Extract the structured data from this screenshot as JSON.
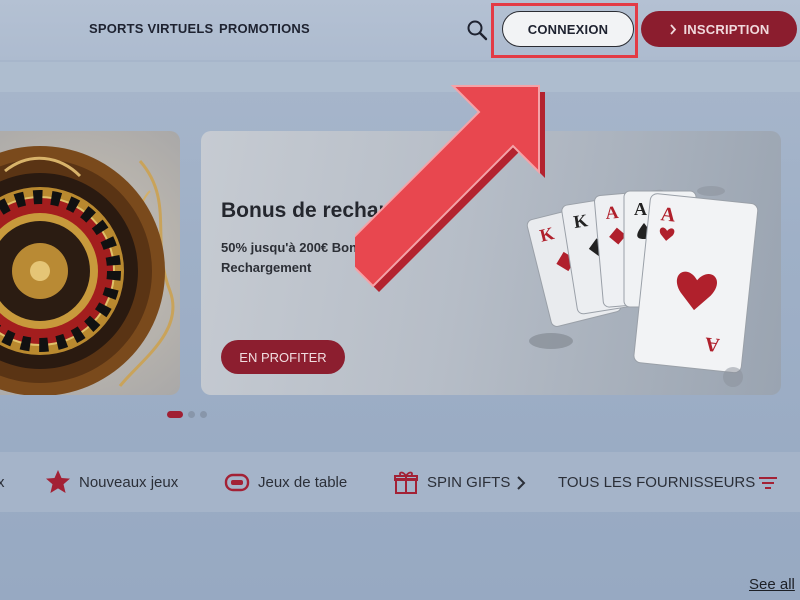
{
  "header": {
    "nav": [
      "SPORTS VIRTUELS",
      "PROMOTIONS"
    ],
    "login_label": "CONNEXION",
    "register_label": "INSCRIPTION"
  },
  "carousel": {
    "active_slide": {
      "title": "Bonus de recharge",
      "description": "50% jusqu'à 200€ Bonus Rechargement",
      "cta_label": "EN PROFITER"
    },
    "pagination": {
      "count": 3,
      "active_index": 0
    }
  },
  "categories": {
    "items": [
      {
        "label": "Nouveaux jeux",
        "icon": "star-icon"
      },
      {
        "label": "Jeux de table",
        "icon": "table-games-icon"
      },
      {
        "label": "SPIN GIFTS",
        "icon": "gift-icon"
      }
    ],
    "providers_label": "TOUS LES FOURNISSEURS"
  },
  "see_all_label": "See all",
  "colors": {
    "brand": "#8b1d2e",
    "highlight": "#e33b45",
    "arrow": "#e8474f"
  }
}
